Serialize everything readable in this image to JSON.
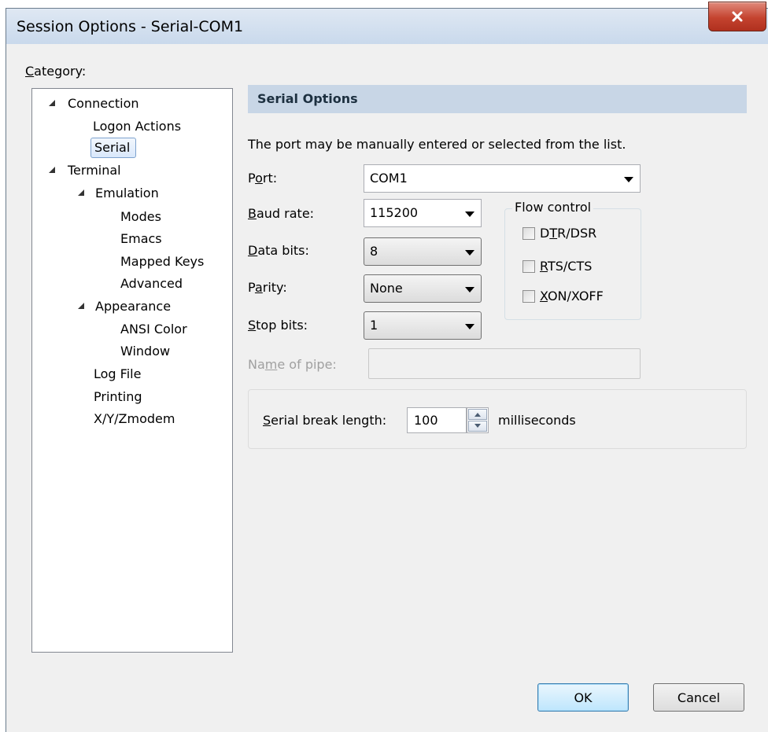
{
  "window": {
    "title": "Session Options - Serial-COM1",
    "close_glyph": "X"
  },
  "category": {
    "label_underline": "C",
    "label_rest": "ategory:",
    "tree": [
      {
        "label": "Connection",
        "expanded": true
      },
      {
        "label": "Logon Actions"
      },
      {
        "label": "Serial",
        "selected": true
      },
      {
        "label": "Terminal",
        "expanded": true
      },
      {
        "label": "Emulation",
        "expanded": true
      },
      {
        "label": "Modes"
      },
      {
        "label": "Emacs"
      },
      {
        "label": "Mapped Keys"
      },
      {
        "label": "Advanced"
      },
      {
        "label": "Appearance",
        "expanded": true
      },
      {
        "label": "ANSI Color"
      },
      {
        "label": "Window"
      },
      {
        "label": "Log File"
      },
      {
        "label": "Printing"
      },
      {
        "label": "X/Y/Zmodem"
      }
    ]
  },
  "serial": {
    "header": "Serial Options",
    "description": "The port may be manually entered or selected from the list.",
    "port": {
      "label_a": "P",
      "label_u": "o",
      "label_b": "rt:",
      "value": "COM1"
    },
    "baud": {
      "label_u": "B",
      "label_b": "aud rate:",
      "value": "115200"
    },
    "databits": {
      "label_u": "D",
      "label_b": "ata bits:",
      "value": "8"
    },
    "parity": {
      "label_a": "P",
      "label_u": "a",
      "label_b": "rity:",
      "value": "None"
    },
    "stopbits": {
      "label_u": "S",
      "label_b": "top bits:",
      "value": "1"
    },
    "pipe": {
      "label_a": "Na",
      "label_u": "m",
      "label_b": "e of pipe:",
      "value": ""
    },
    "flow": {
      "label": "Flow control",
      "dtr": {
        "a": "D",
        "u": "T",
        "b": "R/DSR",
        "checked": false
      },
      "rts": {
        "a": "",
        "u": "R",
        "b": "TS/CTS",
        "checked": false
      },
      "xon": {
        "a": "",
        "u": "X",
        "b": "ON/XOFF",
        "checked": false
      }
    },
    "break": {
      "label_u": "S",
      "label_b": "erial break length:",
      "value": "100",
      "unit": "milliseconds"
    }
  },
  "buttons": {
    "ok": "OK",
    "cancel": "Cancel"
  },
  "colors": {
    "header_bg": "#c8d6e6",
    "title_bar": "#d3e0ef",
    "close_button": "#c4432f"
  }
}
